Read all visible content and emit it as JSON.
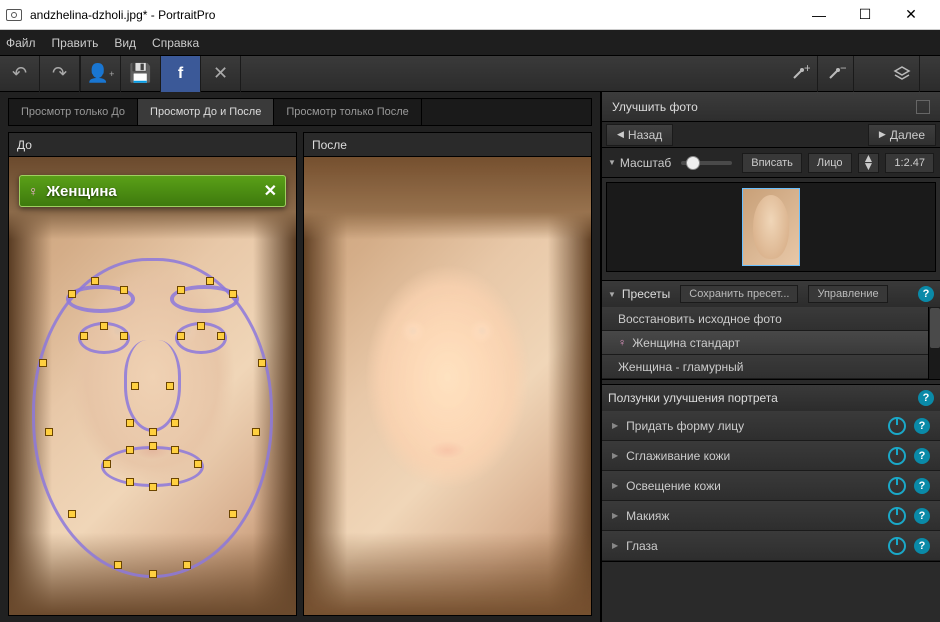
{
  "window": {
    "title": "andzhelina-dzholi.jpg* - PortraitPro"
  },
  "menu": {
    "file": "Файл",
    "edit": "Править",
    "view": "Вид",
    "help": "Справка"
  },
  "tabs": {
    "before_only": "Просмотр только До",
    "before_after": "Просмотр До и После",
    "after_only": "Просмотр только После"
  },
  "views": {
    "before": "До",
    "after": "После"
  },
  "gender": {
    "label": "Женщина"
  },
  "panel": {
    "title": "Улучшить фото"
  },
  "nav": {
    "back": "Назад",
    "next": "Далее"
  },
  "zoom": {
    "label": "Масштаб",
    "fit": "Вписать",
    "face": "Лицо",
    "ratio": "1:2.47"
  },
  "presets": {
    "header": "Пресеты",
    "save": "Сохранить пресет...",
    "manage": "Управление",
    "items": {
      "restore": "Восстановить исходное фото",
      "female_std": "Женщина стандарт",
      "female_glam": "Женщина - гламурный"
    }
  },
  "sliders": {
    "header": "Ползунки улучшения портрета",
    "rows": {
      "shape": "Придать форму лицу",
      "skin": "Сглаживание кожи",
      "light": "Освещение кожи",
      "makeup": "Макияж",
      "eyes": "Глаза"
    }
  }
}
